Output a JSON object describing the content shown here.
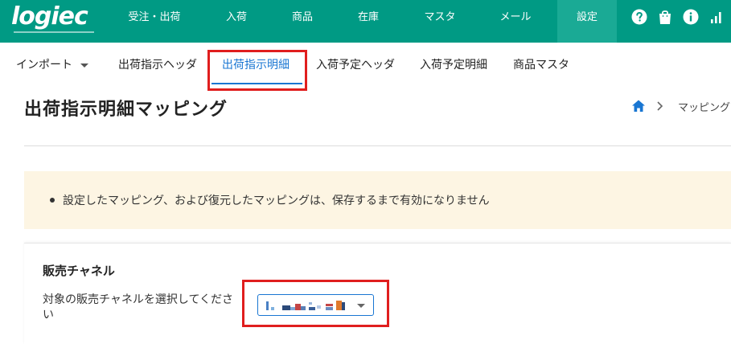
{
  "brand": {
    "logo_text": "logiec"
  },
  "topnav": {
    "items": [
      {
        "label": "受注・出荷"
      },
      {
        "label": "入荷"
      },
      {
        "label": "商品"
      },
      {
        "label": "在庫"
      },
      {
        "label": "マスタ"
      },
      {
        "label": "メール"
      },
      {
        "label": "設定"
      }
    ],
    "active_index": 6,
    "icons": [
      "help-icon",
      "shopping-bag-icon",
      "info-icon",
      "signal-bars-icon"
    ]
  },
  "subnav": {
    "tabs": [
      {
        "label": "インポート"
      },
      {
        "label": "出荷指示ヘッダ"
      },
      {
        "label": "出荷指示明細"
      },
      {
        "label": "入荷予定ヘッダ"
      },
      {
        "label": "入荷予定明細"
      },
      {
        "label": "商品マスタ"
      }
    ],
    "active_index": 2
  },
  "page": {
    "title": "出荷指示明細マッピング",
    "breadcrumb": {
      "home_icon": "home-icon",
      "separator_icon": "chevron-right-icon",
      "current": "マッピング"
    }
  },
  "notice": {
    "items": [
      "設定したマッピング、および復元したマッピングは、保存するまで有効になりません"
    ]
  },
  "channel": {
    "title": "販売チャネル",
    "description": "対象の販売チャネルを選択してください",
    "select_value": ""
  },
  "colors": {
    "topbar": "#009a84",
    "topbar_active": "#1aaa95",
    "accent": "#1976d2",
    "highlight": "#e01e1e",
    "notice_bg": "#fdf5e3"
  }
}
